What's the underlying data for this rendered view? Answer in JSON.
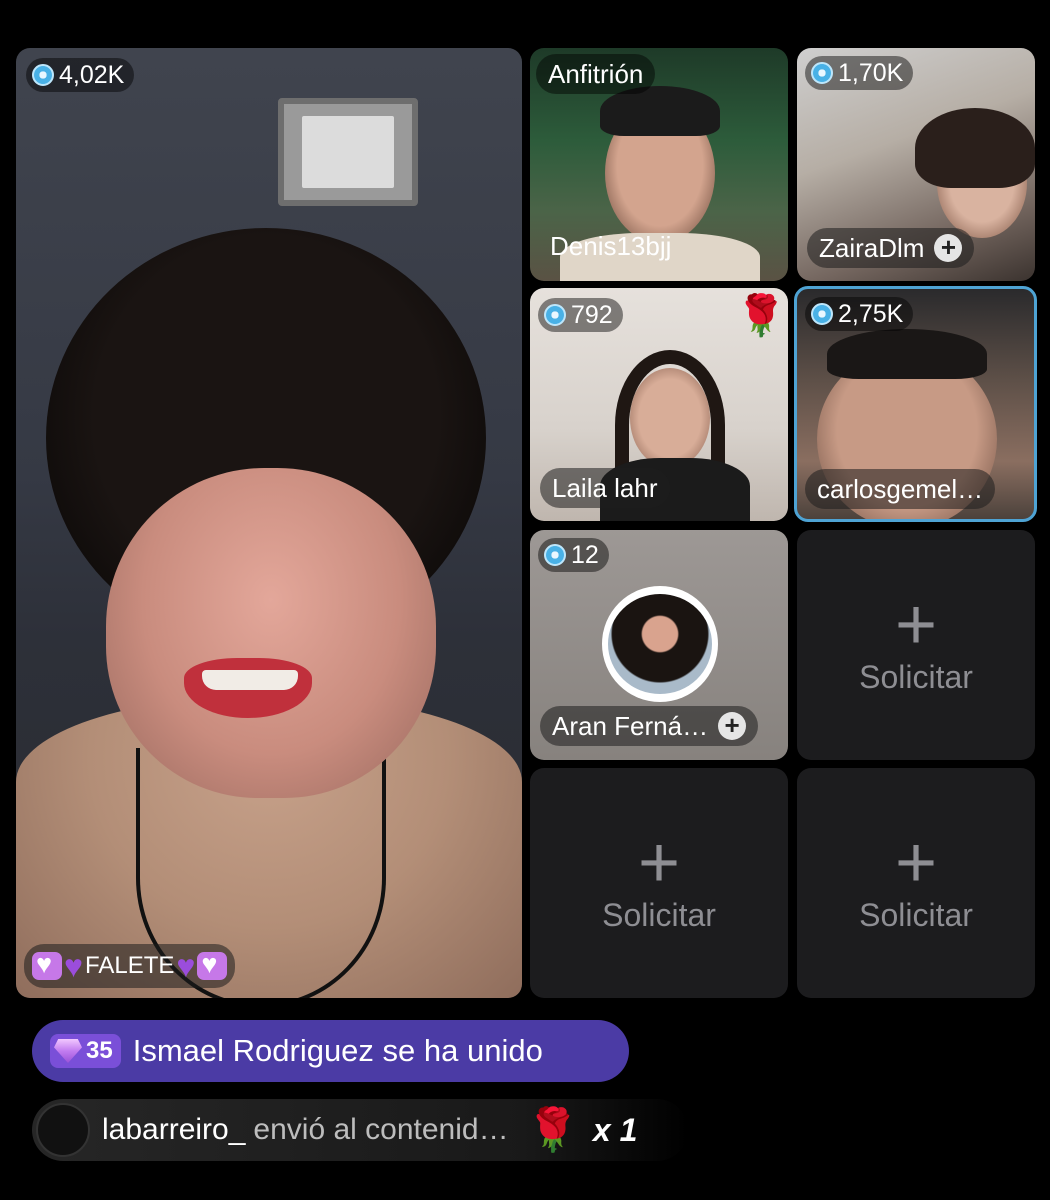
{
  "main_tile": {
    "viewers": "4,02K",
    "name": "FALETE"
  },
  "host_tile": {
    "role_label": "Anfitrión",
    "name": "Denis13bjj"
  },
  "tiles": [
    {
      "viewers": "1,70K",
      "name": "ZairaDlm",
      "follow": "+"
    },
    {
      "viewers": "792",
      "name": "Laila lahr",
      "gift_icon": "rose-icon"
    },
    {
      "viewers": "2,75K",
      "name": "carlosgemel…",
      "active_speaker": true,
      "highlight_color": "#4ea3d4"
    },
    {
      "viewers": "12",
      "name": "Aran Ferná…",
      "follow": "+"
    }
  ],
  "empty_slots": [
    {
      "icon": "plus-icon",
      "label": "Solicitar"
    },
    {
      "icon": "plus-icon",
      "label": "Solicitar"
    },
    {
      "icon": "plus-icon",
      "label": "Solicitar"
    }
  ],
  "join_notification": {
    "level": "35",
    "text": "Ismael Rodriguez se ha unido",
    "color": "#4b3ba5"
  },
  "gift_notification": {
    "user": "labarreiro_",
    "action": "envió al contenid…",
    "gift_icon": "rose-icon",
    "count": "x 1"
  }
}
